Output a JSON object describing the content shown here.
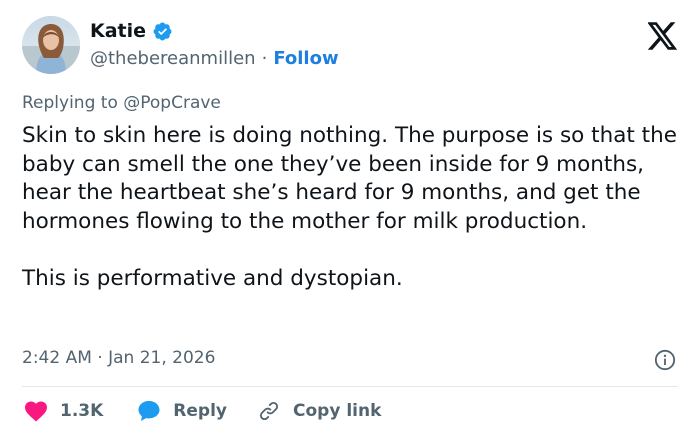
{
  "author": {
    "display_name": "Katie",
    "handle": "@thebereanmillen",
    "separator": "·",
    "follow_label": "Follow"
  },
  "reply_context": {
    "prefix": "Replying to",
    "mention": "@PopCrave"
  },
  "tweet": {
    "paragraphs": [
      "Skin to skin here is doing nothing. The purpose is so that the baby can smell the one they’ve been inside for 9 months, hear the heartbeat she’s heard for 9 months, and get the hormones flowing to the mother for milk production.",
      "This is performative and dystopian."
    ],
    "timestamp": "2:42 AM · Jan 21, 2026"
  },
  "actions": {
    "likes_count": "1.3K",
    "reply_label": "Reply",
    "copy_link_label": "Copy link"
  },
  "icons": {
    "verified": "verified-badge-icon",
    "platform": "x-logo-icon",
    "info": "info-icon",
    "like": "heart-icon",
    "reply": "reply-bubble-icon",
    "link": "link-icon"
  },
  "colors": {
    "accent": "#1d9bf0",
    "like": "#f91880",
    "text": "#0f1419",
    "muted": "#536471"
  }
}
